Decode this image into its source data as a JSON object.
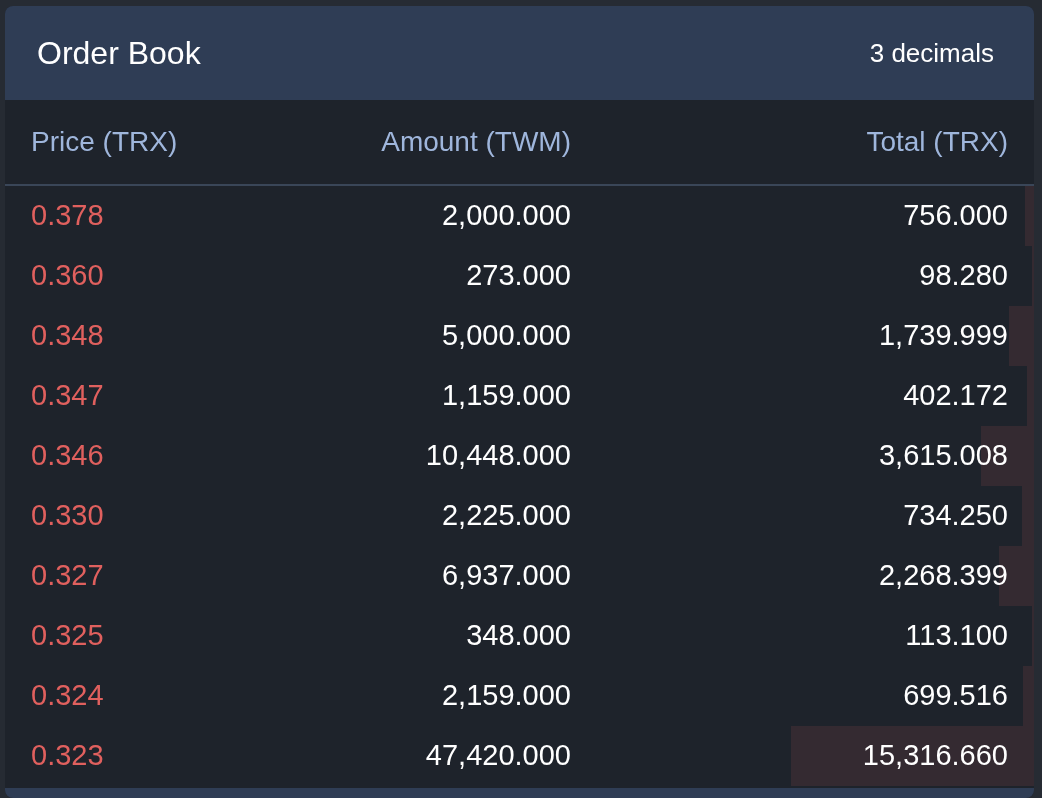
{
  "panel": {
    "title": "Order Book",
    "decimals": "3 decimals"
  },
  "table": {
    "columns": [
      "Price (TRX)",
      "Amount (TWM)",
      "Total (TRX)"
    ],
    "rows": [
      {
        "price": "0.378",
        "amount": "2,000.000",
        "total": "756.000",
        "level": 0.009
      },
      {
        "price": "0.360",
        "amount": "273.000",
        "total": "98.280",
        "level": 0.002
      },
      {
        "price": "0.348",
        "amount": "5,000.000",
        "total": "1,739.999",
        "level": 0.024
      },
      {
        "price": "0.347",
        "amount": "1,159.000",
        "total": "402.172",
        "level": 0.007
      },
      {
        "price": "0.346",
        "amount": "10,448.000",
        "total": "3,615.008",
        "level": 0.052
      },
      {
        "price": "0.330",
        "amount": "2,225.000",
        "total": "734.250",
        "level": 0.012
      },
      {
        "price": "0.327",
        "amount": "6,937.000",
        "total": "2,268.399",
        "level": 0.034
      },
      {
        "price": "0.325",
        "amount": "348.000",
        "total": "113.100",
        "level": 0.002
      },
      {
        "price": "0.324",
        "amount": "2,159.000",
        "total": "699.516",
        "level": 0.011
      },
      {
        "price": "0.323",
        "amount": "47,420.000",
        "total": "15,316.660",
        "level": 0.236
      }
    ]
  }
}
